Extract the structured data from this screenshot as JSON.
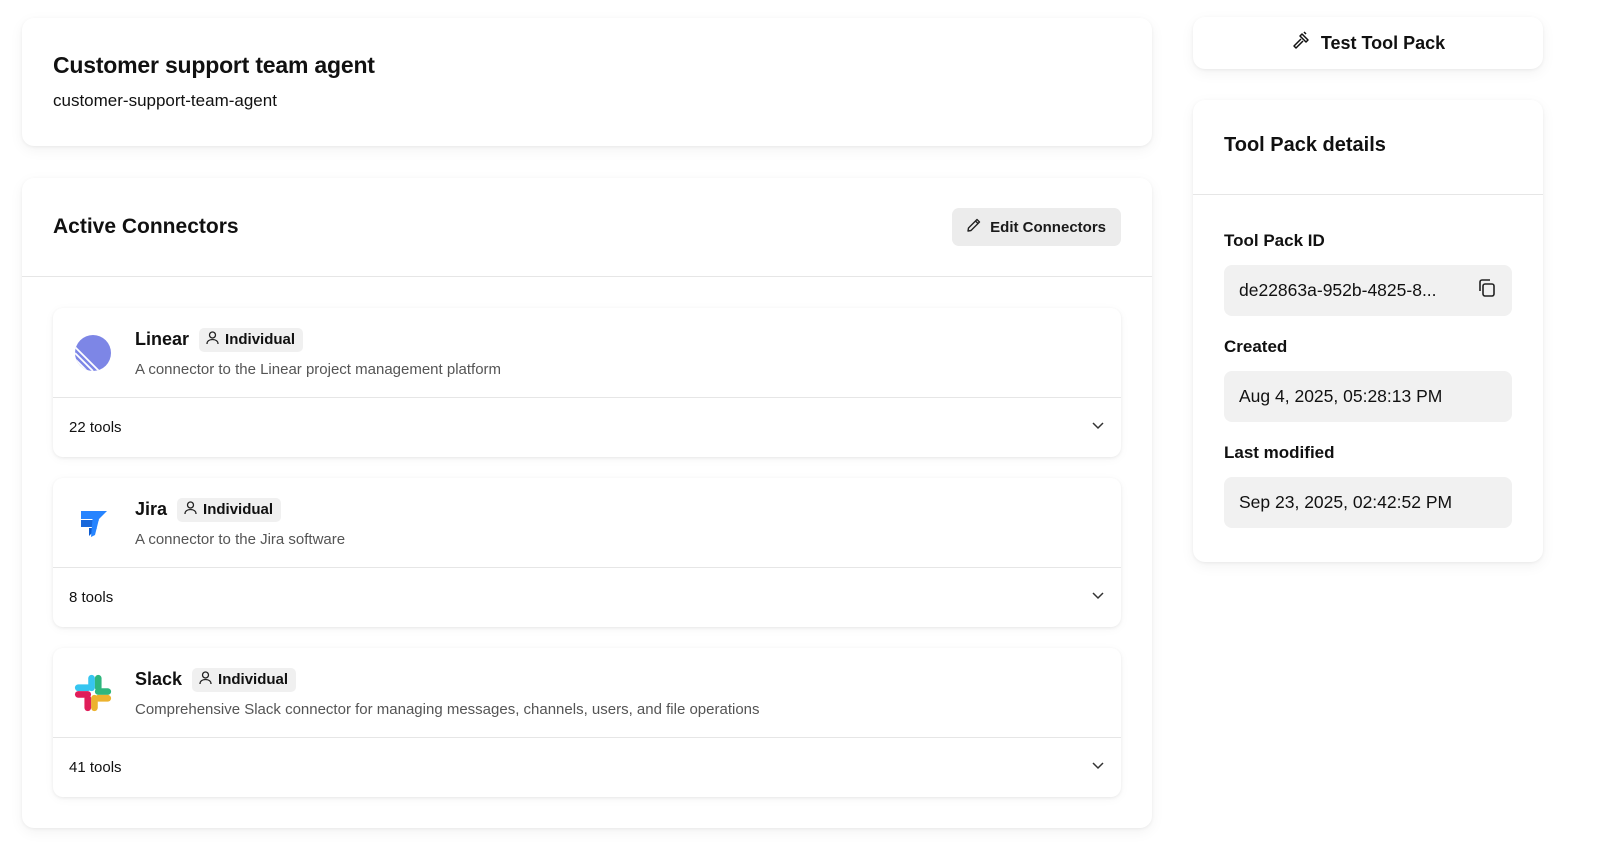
{
  "agent": {
    "title": "Customer support team agent",
    "slug": "customer-support-team-agent"
  },
  "connectors_section": {
    "heading": "Active Connectors",
    "edit_label": "Edit Connectors",
    "items": [
      {
        "name": "Linear",
        "badge": "Individual",
        "description": "A connector to the Linear project management platform",
        "tools": "22 tools",
        "icon": "linear-logo-icon",
        "color": "#5e6ad2"
      },
      {
        "name": "Jira",
        "badge": "Individual",
        "description": "A connector to the Jira software",
        "tools": "8 tools",
        "icon": "jira-logo-icon",
        "color": "#2684ff"
      },
      {
        "name": "Slack",
        "badge": "Individual",
        "description": "Comprehensive Slack connector for managing messages, channels, users, and file operations",
        "tools": "41 tools",
        "icon": "slack-logo-icon",
        "color": "#4a154b"
      }
    ]
  },
  "test_button": {
    "label": "Test Tool Pack",
    "icon": "hammer-icon"
  },
  "details": {
    "heading": "Tool Pack details",
    "id_label": "Tool Pack ID",
    "id_value": "de22863a-952b-4825-8...",
    "created_label": "Created",
    "created_value": "Aug 4, 2025, 05:28:13 PM",
    "modified_label": "Last modified",
    "modified_value": "Sep 23, 2025, 02:42:52 PM"
  }
}
